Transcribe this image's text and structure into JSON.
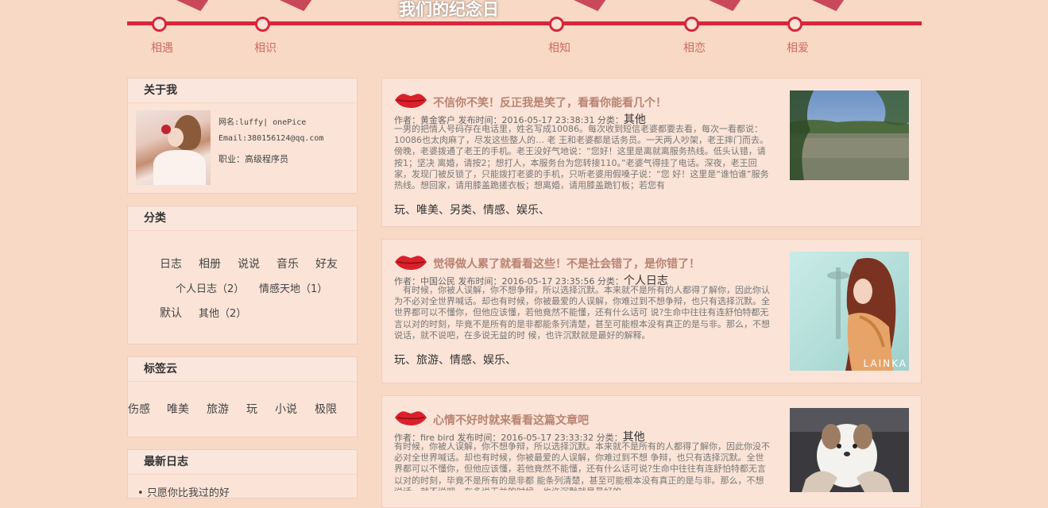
{
  "timeline": {
    "title": "我们的纪念日",
    "points": [
      "相遇",
      "相识",
      "相知",
      "相恋",
      "相爱"
    ]
  },
  "about": {
    "heading": "关于我",
    "name": "网名:luffy| onePice",
    "email": "Email:380156124@qq.com",
    "job": "职业：高级程序员"
  },
  "categories": {
    "heading": "分类",
    "items": [
      "日志",
      "相册",
      "说说",
      "音乐",
      "好友",
      "个人日志（2）",
      "情感天地（1）",
      "默认",
      "其他（2）"
    ]
  },
  "tagcloud": {
    "heading": "标签云",
    "tags": [
      "伤感",
      "唯美",
      "旅游",
      "玩",
      "小说",
      "极限"
    ]
  },
  "recent": {
    "heading": "最新日志",
    "first": "只愿你比我过的好"
  },
  "articles": [
    {
      "title": "不信你不笑！反正我是笑了，看看你能看几个！",
      "meta": "作者：黄金客户 发布时间：2016-05-17 23:38:31 分类：",
      "category": "其他",
      "body": "一男的把情人号码存在电话里，姓名写成10086。每次收到短信老婆都要去看，每次一看都说：10086也太肉麻了，尽发这些整人的… 老 王和老婆都是话务员。一天两人吵架，老王摔门而去。傍晚，老婆拨通了老王的手机。老王没好气地说：“您好！这里是离就离服务热线。低头认错，请按1；坚决 离婚，请按2；想打人，本服务台为您转接110。”老婆气得挂了电话。深夜，老王回家，发现门被反锁了，只能拨打老婆的手机，只听老婆用假嗓子说：“您 好！这里是“谁怕谁”服务热线。想回家，请用膝盖跪搓衣板；想离婚，请用膝盖跪钉板；若您有",
      "tags": "玩、唯美、另类、情感、娱乐、"
    },
    {
      "title": "觉得做人累了就看看这些！不是社会错了，是你错了！",
      "meta": "作者：中国公民 发布时间：2016-05-17 23:35:56 分类：",
      "category": "个人日志",
      "body": "　有时候，你被人误解，你不想争辩，所以选择沉默。本来就不是所有的人都得了解你，因此你认 为不必对全世界喊话。却也有时候，你被最爱的人误解，你难过到不想争辩，也只有选择沉默。全世界都可以不懂你，但他应该懂，若他竟然不能懂，还有什么话可 说?生命中往往有连舒怕特都无言以对的时刻，毕竟不是所有的是非都能条列清楚，甚至可能根本没有真正的是与非。那么，不想说话，就不说吧，在多说无益的时 候，也许沉默就是最好的解释。",
      "tags": "玩、旅游、情感、娱乐、",
      "watermark": "LAINKA"
    },
    {
      "title": "心情不好时就来看看这篇文章吧",
      "meta": "作者：fire bird 发布时间：2016-05-17 23:33:32 分类：",
      "category": "其他",
      "body": "有时候，你被人误解，你不想争辩，所以选择沉默。本来就不是所有的人都得了解你，因此你没不必对全世界喊话。却也有时候，你被最爱的人误解，你难过到不想 争辩，也只有选择沉默。全世界都可以不懂你，但他应该懂，若他竟然不能懂，还有什么话可说?生命中往往有连舒怕特都无言以对的时刻，毕竟不是所有的是非都 能条列清楚，甚至可能根本没有真正的是与非。那么，不想说话，就不说吧，在多说无益的时候，也许沉默就是最好的",
      "tags": ""
    }
  ],
  "colors": {
    "background": "#f8d9c6",
    "timeline_line": "#d8263d",
    "title_text": "#b98372",
    "panel": "#fbe3d7"
  }
}
